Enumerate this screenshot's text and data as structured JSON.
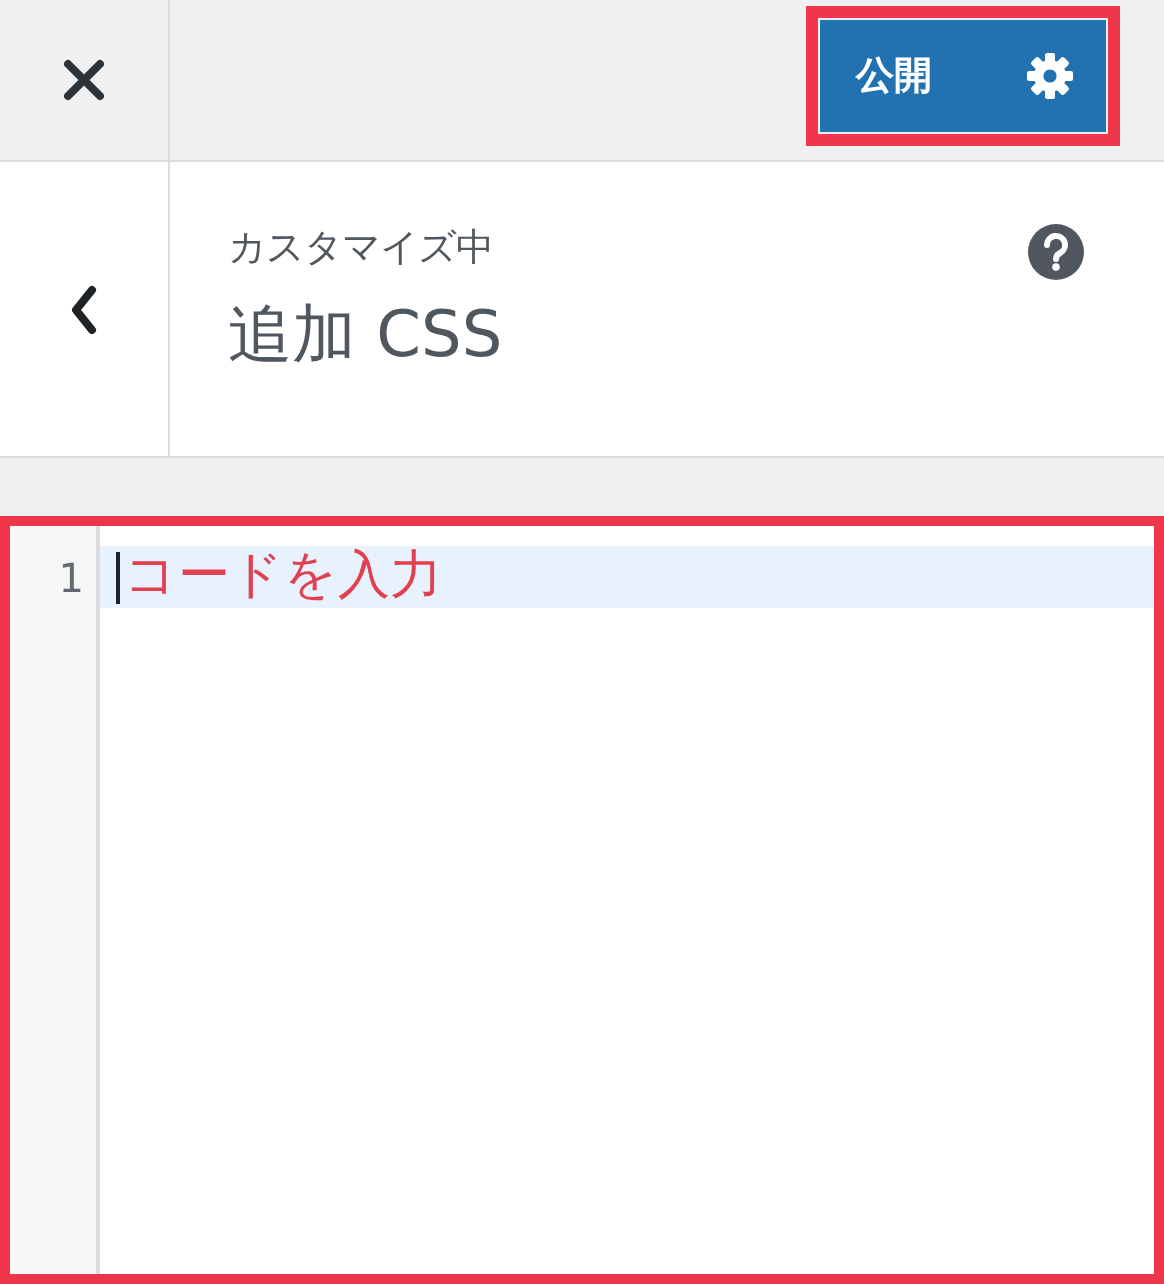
{
  "top_bar": {
    "publish_button": "公開"
  },
  "header": {
    "subtitle": "カスタマイズ中",
    "title": "追加 CSS"
  },
  "editor": {
    "lines": [
      {
        "number": "1",
        "placeholder": "コードを入力",
        "selected": true
      }
    ]
  }
}
